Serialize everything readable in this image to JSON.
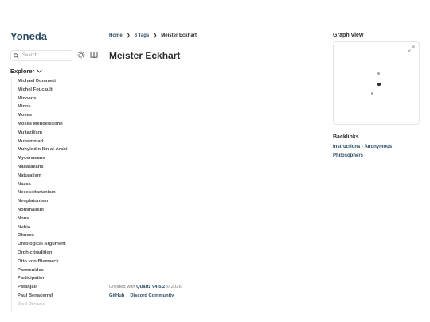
{
  "site": {
    "title": "Yoneda"
  },
  "search": {
    "placeholder": "Search"
  },
  "explorer": {
    "title": "Explorer",
    "items": [
      "Michael Dummett",
      "Michel Foucault",
      "Minoans",
      "Minos",
      "Moses",
      "Moses Mendelssohn",
      "Mu'tazilism",
      "Muhammad",
      "Muhyiddin Ibn al-Arabi",
      "Mycenaeans",
      "Nabataeans",
      "Naturalism",
      "Nazca",
      "Necessitarianism",
      "Neoplatonism",
      "Nominalism",
      "Nous",
      "Nubia",
      "Olmecs",
      "Ontological Argument",
      "Orphic tradition",
      "Otto von Bismarck",
      "Parmenides",
      "Participation",
      "Patanjali",
      "Paul Benacerraf",
      "Paul Ricoeur"
    ]
  },
  "breadcrumb": {
    "home": "Home",
    "tags": "6 Tags",
    "current": "Meister Eckhart",
    "separator": "❯"
  },
  "page": {
    "title": "Meister Eckhart"
  },
  "footer": {
    "credit_prefix": "Created with",
    "quartz": "Quartz v4.5.2",
    "credit_suffix": "© 2026",
    "links": [
      "GitHub",
      "Discord Community"
    ]
  },
  "graph": {
    "title": "Graph View"
  },
  "backlinks": {
    "title": "Backlinks",
    "items": [
      "Instructions - Anonymous",
      "Philosophers"
    ]
  },
  "colors": {
    "accent": "#284b63",
    "text": "#2b2b2b",
    "border": "#e5e5e5"
  }
}
